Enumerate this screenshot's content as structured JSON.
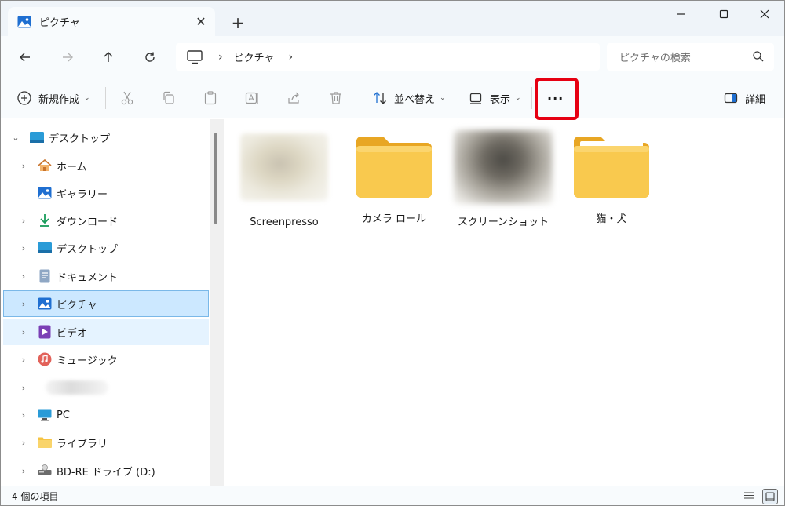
{
  "window": {
    "tab_title": "ピクチャ",
    "close_label": "✕",
    "new_tab_label": "+"
  },
  "address": {
    "crumbs": [
      "ピクチャ"
    ],
    "search_placeholder": "ピクチャの検索"
  },
  "toolbar": {
    "new_label": "新規作成",
    "sort_label": "並べ替え",
    "view_label": "表示",
    "more_label": "···",
    "details_label": "詳細"
  },
  "sidebar": {
    "items": [
      {
        "label": "デスクトップ",
        "icon": "desktop-icon",
        "expanded": true
      },
      {
        "label": "ホーム",
        "icon": "home-icon"
      },
      {
        "label": "ギャラリー",
        "icon": "gallery-icon"
      },
      {
        "label": "ダウンロード",
        "icon": "download-icon"
      },
      {
        "label": "デスクトップ",
        "icon": "desktop-icon"
      },
      {
        "label": "ドキュメント",
        "icon": "document-icon"
      },
      {
        "label": "ピクチャ",
        "icon": "pictures-icon",
        "selected": true
      },
      {
        "label": "ビデオ",
        "icon": "video-icon"
      },
      {
        "label": "ミュージック",
        "icon": "music-icon"
      },
      {
        "label": "",
        "icon": "blurred"
      },
      {
        "label": "PC",
        "icon": "pc-icon"
      },
      {
        "label": "ライブラリ",
        "icon": "library-icon"
      },
      {
        "label": "BD-RE ドライブ (D:)",
        "icon": "drive-icon"
      }
    ]
  },
  "files": [
    {
      "name": "Screenpresso",
      "type": "blurred-thumbnail"
    },
    {
      "name": "カメラ ロール",
      "type": "folder"
    },
    {
      "name": "スクリーンショット",
      "type": "blurred-thumbnail"
    },
    {
      "name": "猫・犬",
      "type": "folder"
    }
  ],
  "status": {
    "item_count": "4 個の項目"
  },
  "colors": {
    "highlight": "#e60012",
    "folder": "#f8c84a",
    "selection": "#cce8ff"
  }
}
